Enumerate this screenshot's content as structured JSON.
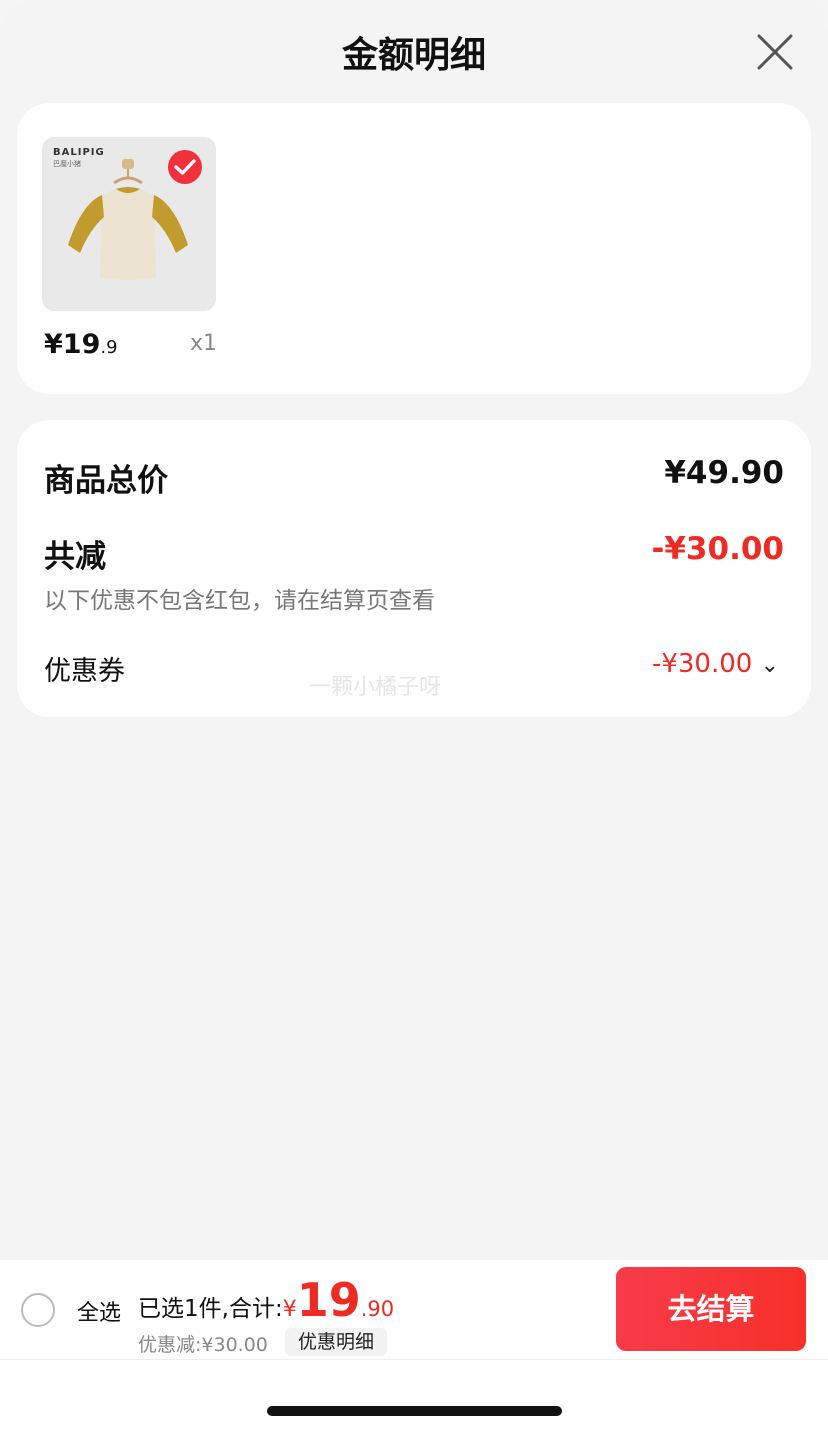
{
  "header": {
    "title": "金额明细",
    "close_icon": "close-icon"
  },
  "product": {
    "brand": "BALIPIG",
    "brand_sub": "巴厘小猪",
    "price_main": "¥19",
    "price_cents": ".9",
    "quantity": "x1",
    "selected": true
  },
  "summary": {
    "total_label": "商品总价",
    "total_value": "¥49.90",
    "discount_label": "共减",
    "discount_value": "-¥30.00",
    "note": "以下优惠不包含红包，请在结算页查看",
    "coupon_label": "优惠券",
    "coupon_value": "-¥30.00",
    "coupon_chevron": "⌄",
    "watermark": "一颗小橘子呀"
  },
  "bottom_bar": {
    "select_all": "全选",
    "selected_text": "已选1件,合计:",
    "currency": "¥",
    "total_int": "19",
    "total_dec": ".90",
    "discount_text": "优惠减:¥30.00",
    "detail_button": "优惠明细",
    "checkout_button": "去结算"
  },
  "colors": {
    "accent_red": "#ee2a23",
    "checkout_gradient_start": "#f73b4a",
    "checkout_gradient_end": "#f7302a"
  }
}
